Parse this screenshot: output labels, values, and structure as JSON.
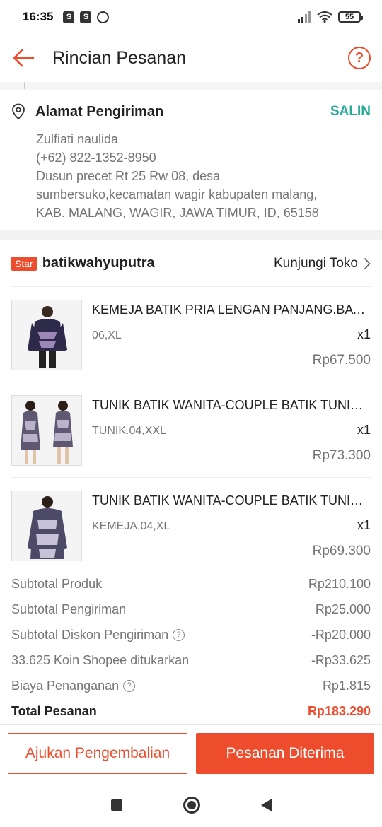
{
  "status": {
    "time": "16:35",
    "battery": "55"
  },
  "header": {
    "title": "Rincian Pesanan"
  },
  "address": {
    "title": "Alamat Pengiriman",
    "copy_label": "SALIN",
    "name": "Zulfiati naulida",
    "phone": "(+62) 822-1352-8950",
    "line1": "Dusun precet Rt 25 Rw 08, desa",
    "line2": "sumbersuko,kecamatan wagir kabupaten malang,",
    "line3": "KAB. MALANG, WAGIR, JAWA TIMUR, ID, 65158"
  },
  "shop": {
    "badge": "Star",
    "name": "batikwahyuputra",
    "visit_label": "Kunjungi Toko"
  },
  "items": [
    {
      "name": "KEMEJA BATIK PRIA LENGAN PANJANG.BATIK PRIA",
      "variant": "06,XL",
      "qty": "x1",
      "price": "Rp67.500"
    },
    {
      "name": "TUNIK BATIK WANITA-COUPLE BATIK TUNIK WANITA",
      "variant": "TUNIK.04,XXL",
      "qty": "x1",
      "price": "Rp73.300"
    },
    {
      "name": "TUNIK BATIK WANITA-COUPLE BATIK TUNIK WANITA",
      "variant": "KEMEJA.04,XL",
      "qty": "x1",
      "price": "Rp69.300"
    }
  ],
  "summary": {
    "subtotal_product_label": "Subtotal Produk",
    "subtotal_product": "Rp210.100",
    "subtotal_shipping_label": "Subtotal Pengiriman",
    "subtotal_shipping": "Rp25.000",
    "shipping_discount_label": "Subtotal Diskon Pengiriman",
    "shipping_discount": "-Rp20.000",
    "coins_label": "33.625 Koin Shopee ditukarkan",
    "coins": "-Rp33.625",
    "handling_label": "Biaya Penanganan",
    "handling": "Rp1.815",
    "total_label": "Total Pesanan",
    "total": "Rp183.290"
  },
  "actions": {
    "return_label": "Ajukan Pengembalian",
    "received_label": "Pesanan Diterima"
  },
  "colors": {
    "accent": "#ee4d2d",
    "teal": "#26aa99"
  }
}
